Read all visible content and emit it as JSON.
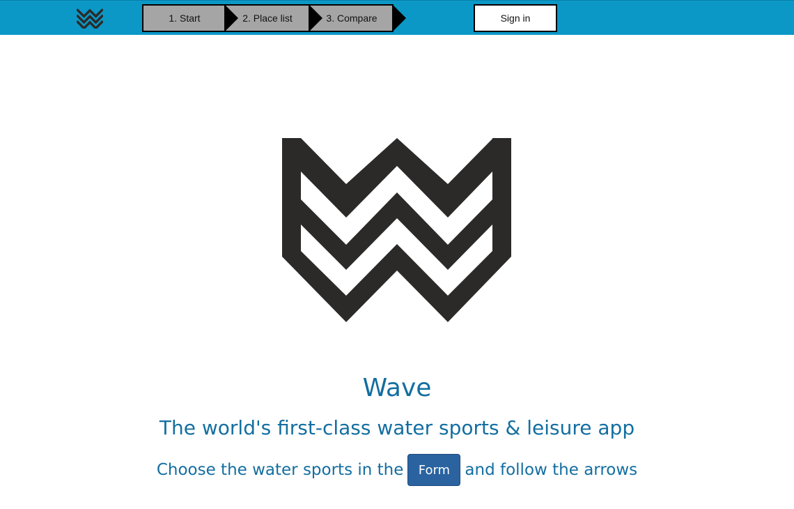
{
  "nav": {
    "logo_icon": "wave-logo-icon",
    "steps": [
      {
        "label": "1. Start"
      },
      {
        "label": "2. Place list"
      },
      {
        "label": "3. Compare"
      }
    ],
    "signin_label": "Sign in"
  },
  "hero": {
    "logo_icon": "wave-logo-icon",
    "title": "Wave",
    "subtitle": "The world's first-class water sports & leisure app",
    "instruction_before": "Choose the water sports in the",
    "form_button_label": "Form",
    "instruction_after": "and follow the arrows"
  },
  "colors": {
    "topbar": "#0b98c6",
    "step_bg": "#a5a5a5",
    "heading_text": "#136ea0",
    "form_button": "#2a63a0",
    "logo": "#2c2a29"
  }
}
